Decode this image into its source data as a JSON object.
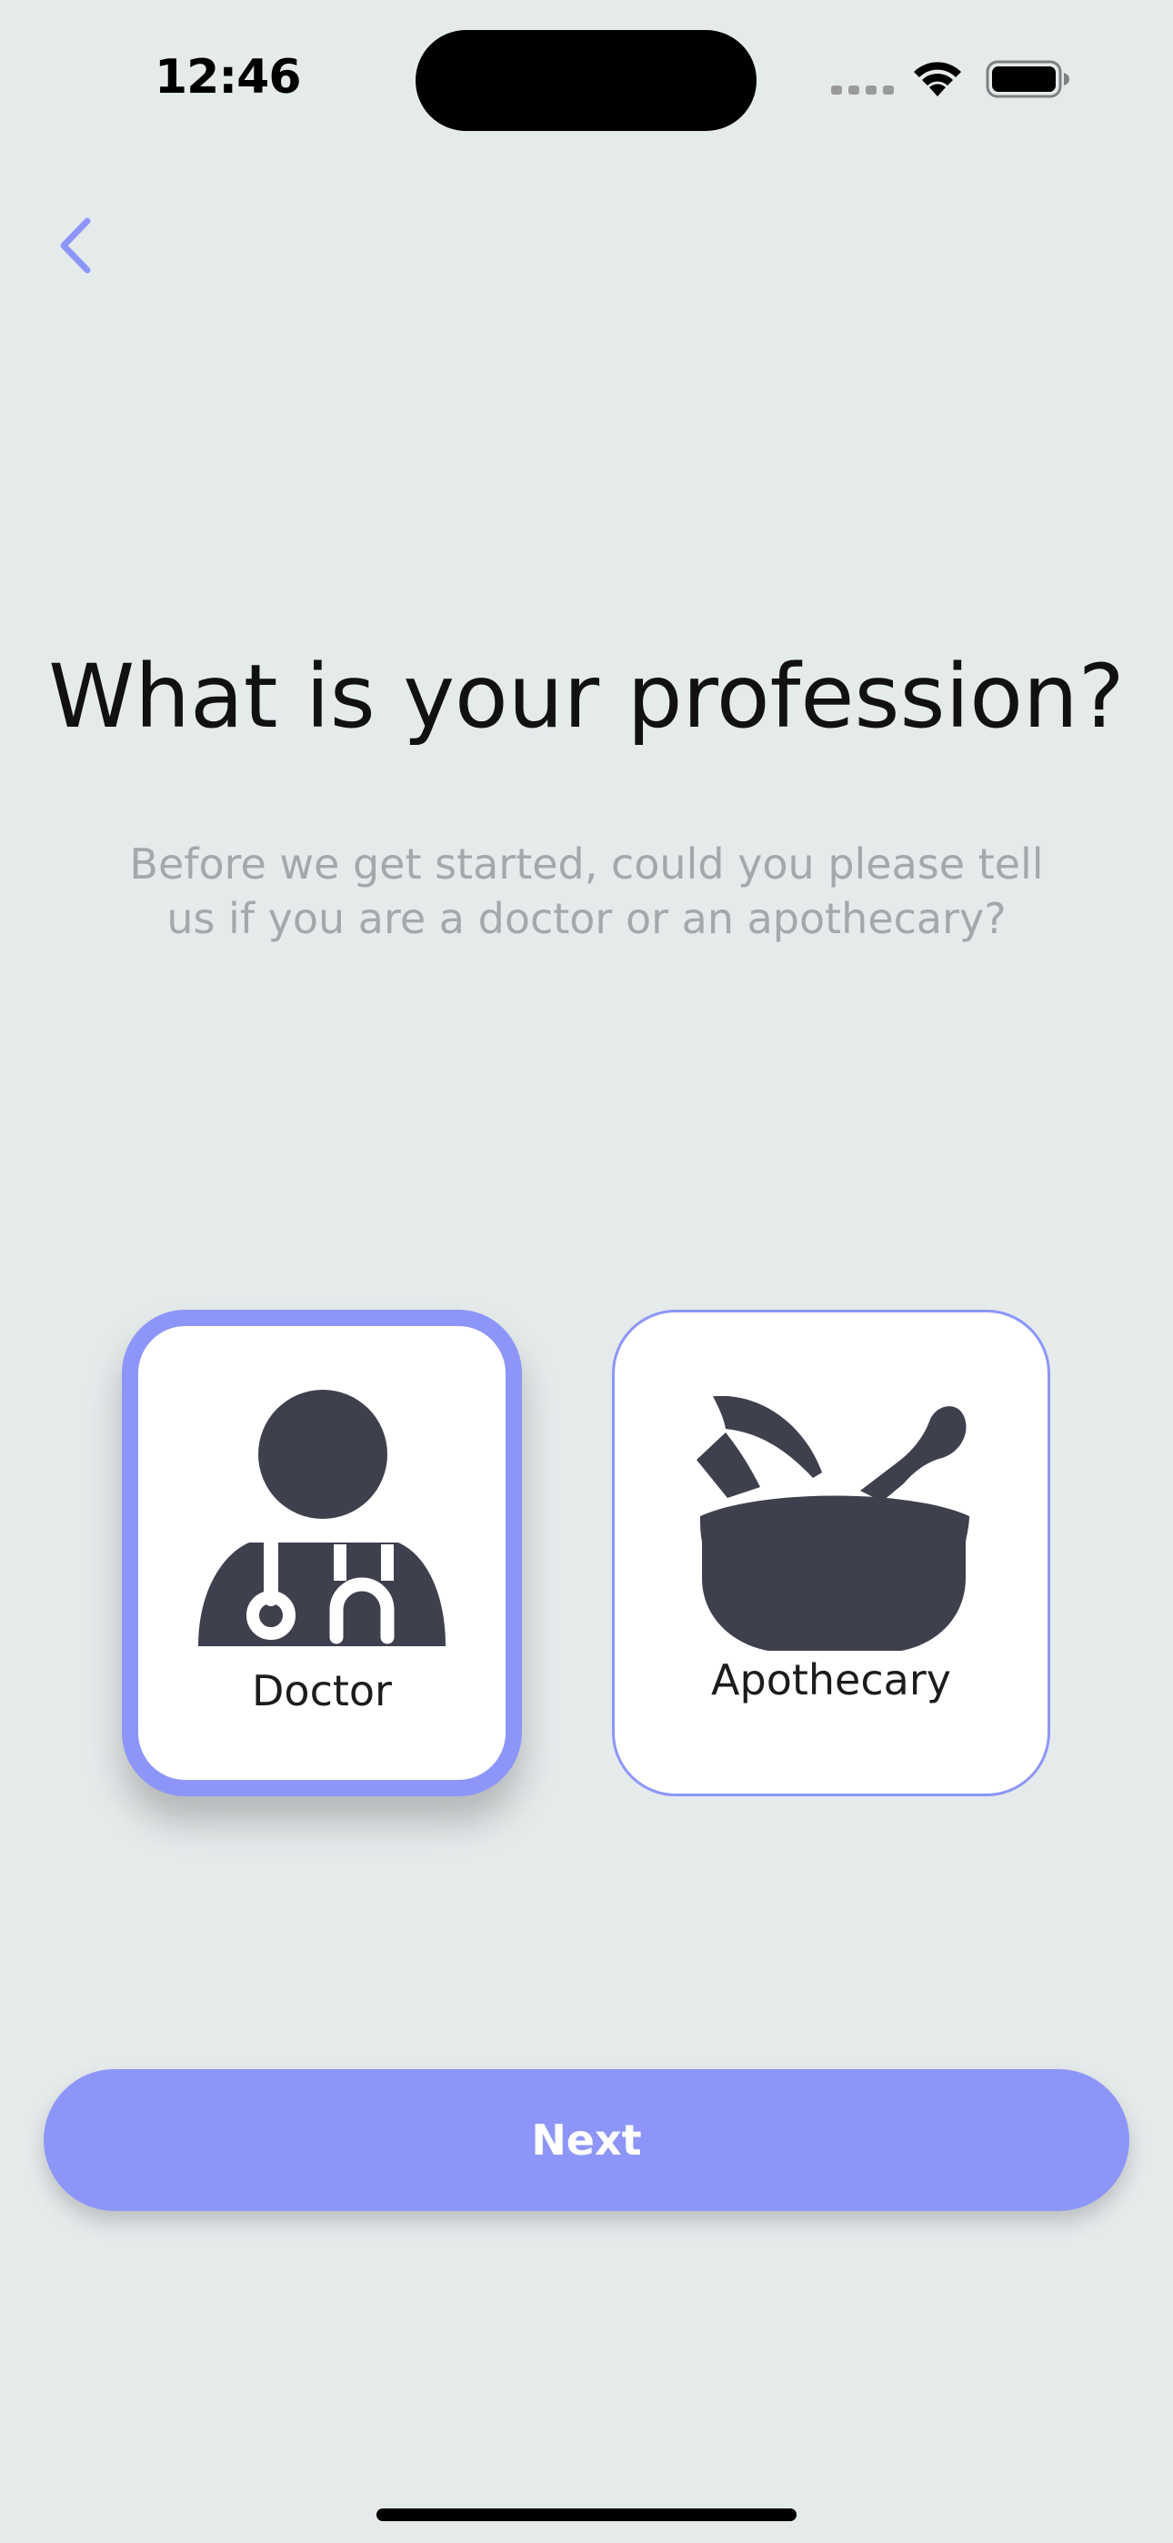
{
  "status_bar": {
    "time": "12:46"
  },
  "icons": {
    "back": "chevron-left-icon",
    "doctor": "doctor-stethoscope-icon",
    "apothecary": "mortar-pestle-icon",
    "signal": "cellular-signal-icon",
    "wifi": "wifi-icon",
    "battery": "battery-icon"
  },
  "header": {
    "title": "What is your profession?",
    "subtitle": "Before we get started, could you please tell us if you are a doctor or an apothecary?"
  },
  "options": [
    {
      "label": "Doctor",
      "selected": true
    },
    {
      "label": "Apothecary",
      "selected": false
    }
  ],
  "actions": {
    "next_label": "Next"
  },
  "colors": {
    "background": "#e5eaeb",
    "accent": "#8d96f8",
    "icon": "#3f404e",
    "card": "#ffffff"
  }
}
